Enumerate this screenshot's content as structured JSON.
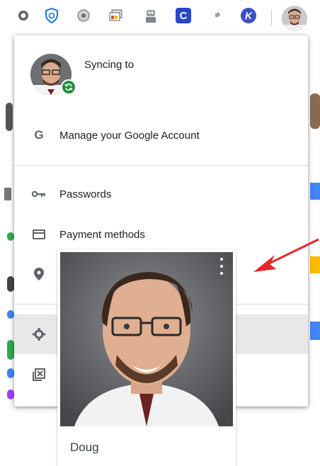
{
  "toolbar": {
    "extensions": [
      {
        "icon": "ghost-extension-icon"
      },
      {
        "icon": "shield-extension-icon"
      },
      {
        "icon": "gauge-extension-icon"
      },
      {
        "icon": "screencast-extension-icon"
      },
      {
        "icon": "robot-extension-icon"
      },
      {
        "icon": "c-extension-icon",
        "glyph": "C"
      },
      {
        "icon": "puzzle-extension-icon"
      },
      {
        "icon": "k-extension-icon",
        "glyph": "K"
      }
    ]
  },
  "menu": {
    "sync_text": "Syncing to",
    "items": [
      {
        "label": "Manage your Google Account",
        "icon": "google-g-icon"
      },
      {
        "label": "Passwords",
        "icon": "key-icon"
      },
      {
        "label": "Payment methods",
        "icon": "credit-card-icon"
      },
      {
        "label": "",
        "icon": "location-pin-icon"
      },
      {
        "label": "",
        "icon": "gear-icon"
      },
      {
        "label": "",
        "icon": "close-window-icon"
      }
    ]
  },
  "profile_card": {
    "name": "Doug"
  },
  "colors": {
    "sync_badge": "#1e8e3e",
    "annotation_arrow": "#e8262b",
    "menu_highlight": "#e8e8e8"
  }
}
